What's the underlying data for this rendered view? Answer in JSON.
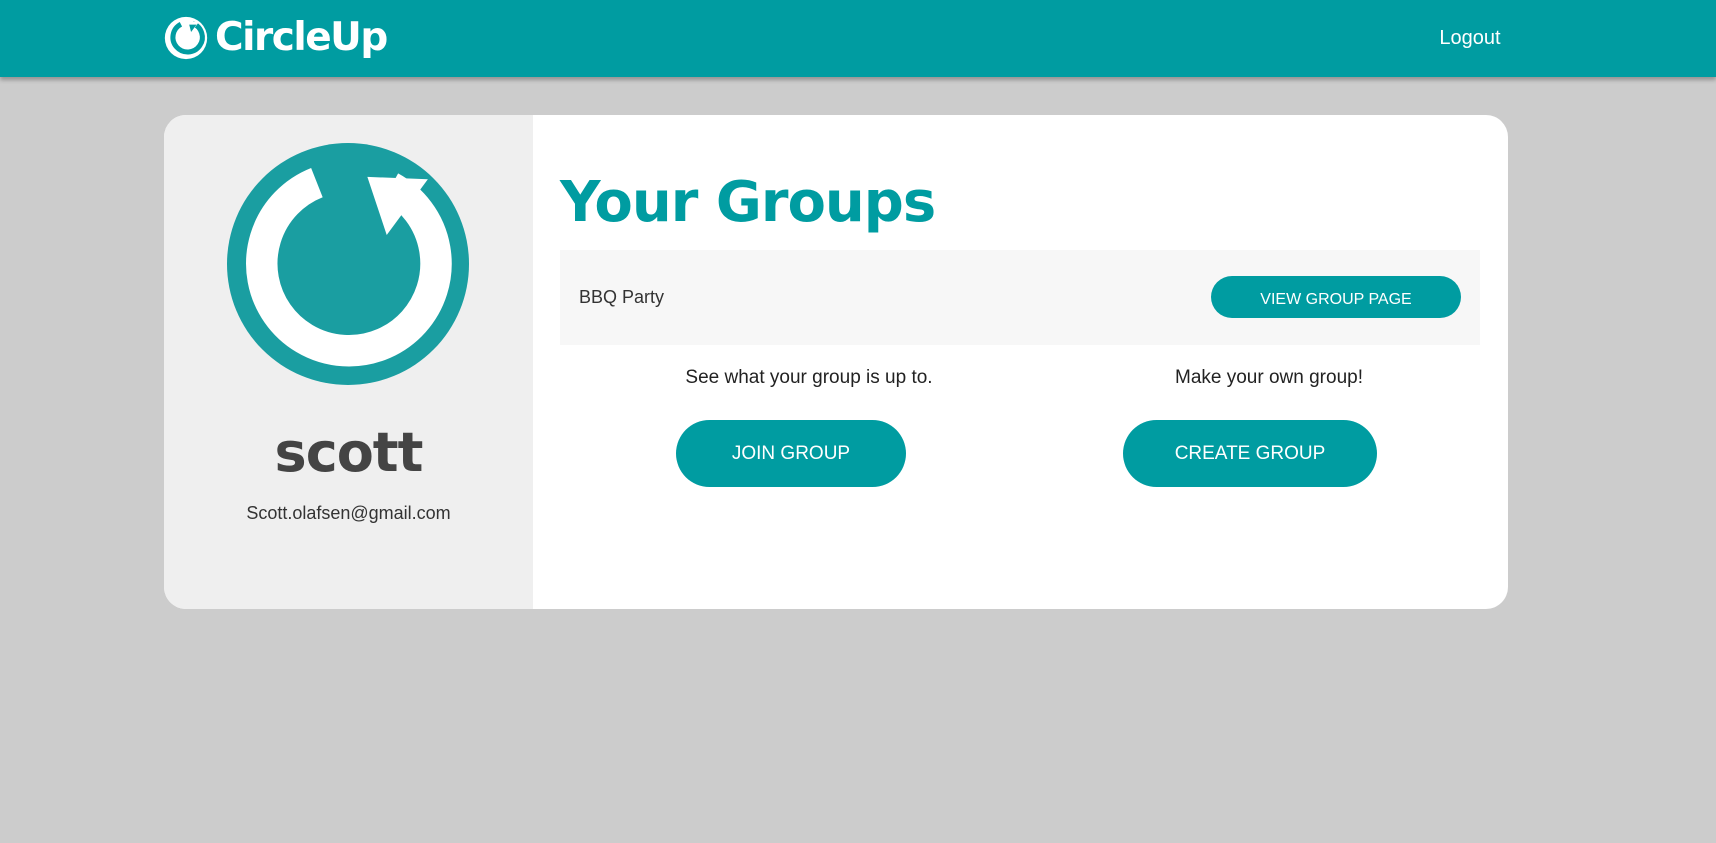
{
  "header": {
    "brand": "CircleUp",
    "logout_label": "Logout"
  },
  "profile": {
    "username": "scott",
    "email": "Scott.olafsen@gmail.com"
  },
  "groups": {
    "title": "Your Groups",
    "items": [
      {
        "name": "BBQ Party",
        "button_label": "VIEW GROUP PAGE"
      }
    ]
  },
  "actions": {
    "join": {
      "text": "See what your group is up to.",
      "button_label": "JOIN GROUP"
    },
    "create": {
      "text": "Make your own group!",
      "button_label": "CREATE GROUP"
    }
  },
  "colors": {
    "brand": "#009ca1",
    "avatar": "#1a9ea1",
    "page_background": "#cccccc",
    "profile_panel": "#efefef"
  },
  "icons": {
    "brand": "circle-arrow-logo-icon",
    "avatar": "circle-arrow-avatar-icon"
  }
}
